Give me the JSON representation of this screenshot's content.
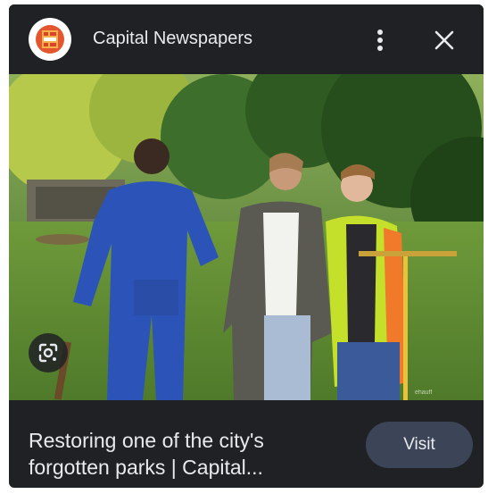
{
  "header": {
    "source_name": "Capital Newspapers",
    "logo_icon": "capital-newspapers-logo",
    "more_icon": "more-vert-icon",
    "close_icon": "close-icon"
  },
  "image": {
    "lens_icon": "google-lens-icon"
  },
  "footer": {
    "caption_line1": "Restoring one of the city's",
    "caption_line2": "forgotten parks | Capital...",
    "visit_label": "Visit"
  },
  "colors": {
    "background": "#202124",
    "text": "#e8eaed",
    "visit_button": "#3c4557",
    "logo_red": "#d9432b",
    "logo_orange": "#f0a23a"
  }
}
